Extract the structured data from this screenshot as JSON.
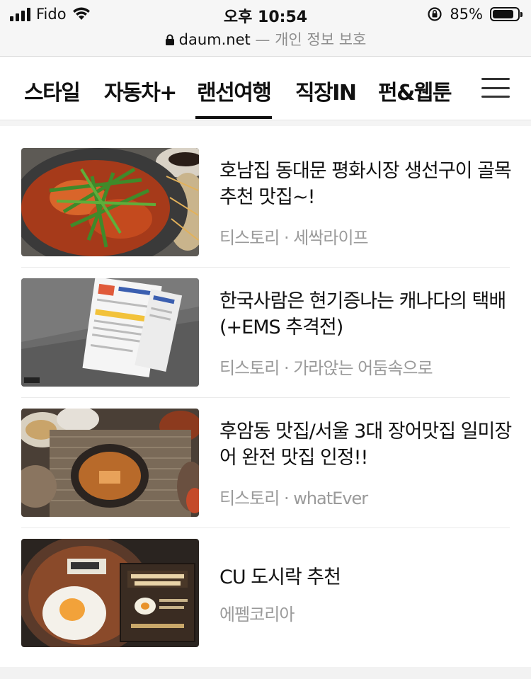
{
  "status_bar": {
    "carrier": "Fido",
    "time": "오후 10:54",
    "battery_percent": "85%",
    "battery_level": 0.85,
    "icons": [
      "signal-icon",
      "wifi-icon",
      "rotation-lock-icon",
      "battery-icon"
    ]
  },
  "url_bar": {
    "domain": "daum.net",
    "subtitle": " — 개인 정보 보호"
  },
  "nav": {
    "tabs": [
      {
        "label": "스타일",
        "active": false
      },
      {
        "label": "자동차+",
        "active": false
      },
      {
        "label": "랜선여행",
        "active": true
      },
      {
        "label": "직장IN",
        "active": false
      },
      {
        "label": "펀&웹툰",
        "active": false
      }
    ],
    "menu_icon": "hamburger-menu-icon"
  },
  "articles": [
    {
      "title": "호남집 동대문 평화시장 생선구이 골목 추천 맛집~!",
      "source": "티스토리 · 세싹라이프",
      "thumbnail": "food-stirfry-photo"
    },
    {
      "title": "한국사람은 현기증나는 캐나다의 택배 (+EMS 추격전)",
      "source": "티스토리 · 가라앉는 어둠속으로",
      "thumbnail": "parcel-receipts-photo"
    },
    {
      "title": "후암동 맛집/서울 3대 장어맛집 일미장어 완전 맛집 인정!!",
      "source": "티스토리 · whatEver",
      "thumbnail": "grilled-eel-photo"
    },
    {
      "title": "CU 도시락 추천",
      "source": "에펨코리아",
      "thumbnail": "lunchbox-photo"
    }
  ],
  "colors": {
    "text": "#111111",
    "source_text": "#9a9a9a",
    "status_bg": "#f6f6f6"
  }
}
